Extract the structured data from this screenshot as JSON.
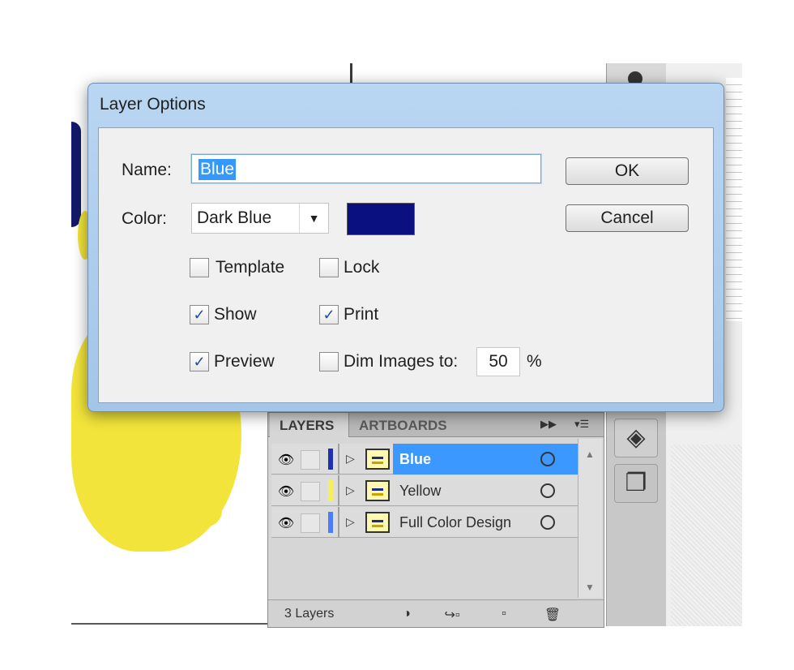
{
  "dialog": {
    "title": "Layer Options",
    "name_label": "Name:",
    "name_value": "Blue",
    "color_label": "Color:",
    "color_value": "Dark Blue",
    "swatch_color": "#0a1080",
    "ok_label": "OK",
    "cancel_label": "Cancel",
    "checkboxes": {
      "template": {
        "label": "Template",
        "checked": false
      },
      "lock": {
        "label": "Lock",
        "checked": false
      },
      "show": {
        "label": "Show",
        "checked": true
      },
      "print": {
        "label": "Print",
        "checked": true
      },
      "preview": {
        "label": "Preview",
        "checked": true
      },
      "dim": {
        "label": "Dim Images to:",
        "checked": false
      }
    },
    "dim_value": "50",
    "dim_unit": "%"
  },
  "panel": {
    "tabs": [
      "LAYERS",
      "ARTBOARDS"
    ],
    "layers": [
      {
        "name": "Blue",
        "color": "#1f2fb0",
        "selected": true
      },
      {
        "name": "Yellow",
        "color": "#f6ee5a",
        "selected": false
      },
      {
        "name": "Full Color Design",
        "color": "#4d7dff",
        "selected": false
      }
    ],
    "footer_count": "3 Layers"
  },
  "icons": {
    "eye": "eye-icon",
    "checkmark": "✓",
    "dropdown": "▼",
    "expand": "▷"
  }
}
